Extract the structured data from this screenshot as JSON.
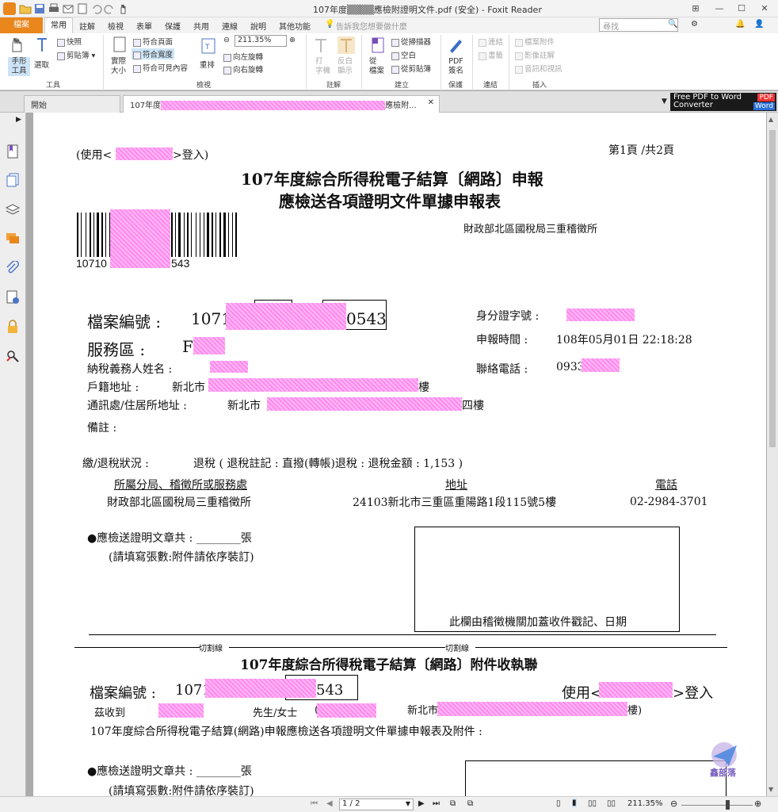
{
  "window": {
    "title": "107年度▒▒▒▒應檢附證明文件.pdf (安全) - Foxit Reader"
  },
  "ribbon_tabs": {
    "file": "檔案",
    "home": "常用",
    "items": [
      "註解",
      "檢視",
      "表單",
      "保護",
      "共用",
      "連線",
      "說明",
      "其他功能"
    ],
    "tell_me": "告訴我您想要做什麼",
    "search_placeholder": "尋找"
  },
  "ribbon": {
    "hand_tool": "手形\n工具",
    "select": "選取",
    "snapshot": "快照",
    "clipboard": "剪貼簿",
    "actual_size": "實際\n大小",
    "fit_page": "符合頁面",
    "fit_width": "符合寬度",
    "fit_visible": "符合可見內容",
    "reflow": "重排",
    "zoom_value": "211.35%",
    "rotate_left": "向左旋轉",
    "rotate_right": "向右旋轉",
    "typewriter": "打\n字機",
    "highlight": "反白\n顯示",
    "from_file": "從\n檔案",
    "from_scanner": "從掃描器",
    "blank": "空白",
    "from_clipboard": "從剪貼簿",
    "pdf_sign": "PDF\n簽名",
    "link": "連結",
    "bookmark": "書籤",
    "file_attachment": "檔案附件",
    "image_annotation": "影像註解",
    "audio_video": "音訊和視訊",
    "groups": [
      "工具",
      "檢視",
      "註解",
      "建立",
      "保護",
      "連結",
      "插入"
    ]
  },
  "doc_tabs": {
    "start": "開始",
    "current_prefix": "107年度",
    "current_suffix": "應檢附...",
    "ad_line1": "Free PDF to Word",
    "ad_line2": "Converter",
    "ad_badge1": "PDF",
    "ad_badge2": "Word"
  },
  "sidebar_icons": [
    "bookmark-icon",
    "pages-icon",
    "layers-icon",
    "comments-icon",
    "attachment-icon",
    "signature-icon",
    "security-icon",
    "search-tool-icon"
  ],
  "pdf": {
    "login_prefix": "(使用<",
    "login_suffix": ">登入)",
    "page_info": "第1頁 /共2頁",
    "title_line1": "107年度綜合所得稅電子結算〔網路〕申報",
    "title_line2": "應檢送各項證明文件單據申報表",
    "office": "財政部北區國稅局三重稽徵所",
    "barcode_prefix": "10710",
    "barcode_suffix": "543",
    "file_no_label": "檔案編號 :",
    "file_no_prefix": "1071",
    "file_no_suffix": "0543",
    "service_area_label": "服務區 :",
    "service_area_value": "F",
    "taxpayer_label": "納稅義務人姓名 :",
    "household_label": "戶籍地址 :",
    "household_prefix": "新北市",
    "household_suffix": "樓",
    "mailing_label": "通訊處/住居所地址 :",
    "mailing_prefix": "新北市",
    "mailing_suffix": "四樓",
    "remark_label": "備註 :",
    "id_label": "身分證字號 :",
    "time_label": "申報時間 :",
    "time_value": "108年05月01日  22:18:28",
    "phone_label": "聯絡電話 :",
    "phone_prefix": "0933",
    "status_label": "繳/退稅狀況 :",
    "status_value": "退稅 ( 退稅註記 : 直撥(轉帳)退稅 : 退稅金額 : 1,153 )",
    "col_office": "所屬分局、稽徵所或服務處",
    "col_address": "地址",
    "col_phone": "電話",
    "row_office": "財政部北區國稅局三重稽徵所",
    "row_address": "24103新北市三重區重陽路1段115號5樓",
    "row_phone": "02-2984-3701",
    "docs_count": "●應檢送證明文章共 :  ________張",
    "docs_note": "(請填寫張數:附件請依序裝訂)",
    "stamp_box": "此欄由稽徵機關加蓋收件戳記、日期",
    "cut_line": "切割線",
    "receipt_title": "107年度綜合所得稅電子結算〔網路〕附件收執聯",
    "receipt_file_label": "檔案編號 :",
    "receipt_file_prefix": "1071",
    "receipt_file_suffix": "543",
    "receipt_login_prefix": "使用<",
    "receipt_login_suffix": ">登入",
    "received_from": "茲收到",
    "mr_ms": "先生/女士",
    "paren_open": "(",
    "receipt_addr_prefix": "新北市",
    "receipt_addr_suffix": "樓)",
    "receipt_body": "107年度綜合所得稅電子結算(網路)申報應檢送各項證明文件單據申報表及附件 :",
    "docs_count2": "●應檢送證明文章共 :  ________張",
    "docs_note2": "(請填寫張數:附件請依序裝訂)",
    "watermark": "鑫部落"
  },
  "statusbar": {
    "page_field": "1 / 2",
    "zoom": "211.35%"
  },
  "colors": {
    "accent": "#e9861c",
    "redaction": "#ff88ee"
  }
}
